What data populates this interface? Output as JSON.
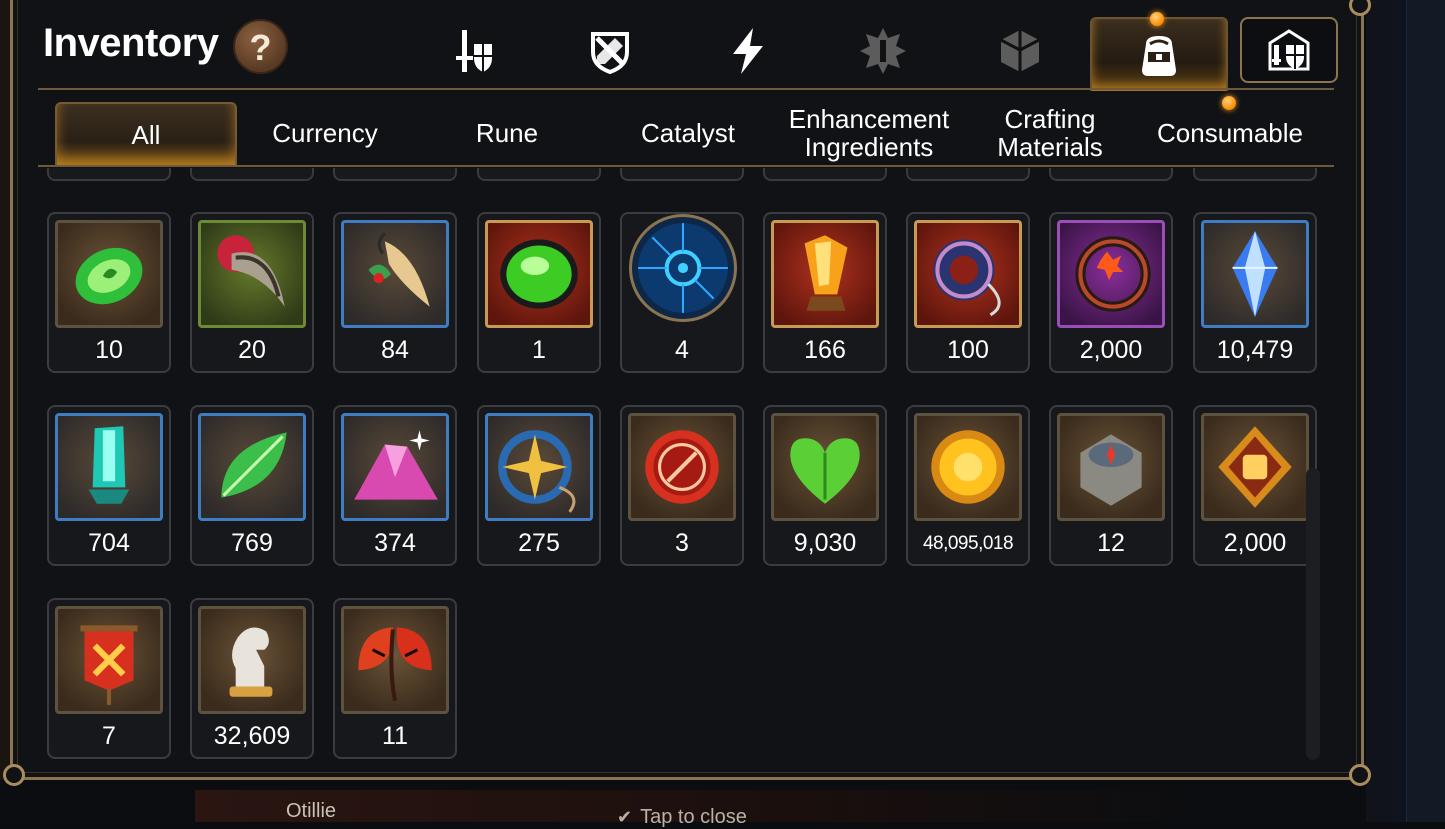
{
  "title": "Inventory",
  "help_label": "?",
  "top_tabs": [
    {
      "icon": "sword-shield-icon"
    },
    {
      "icon": "crossed-shield-icon"
    },
    {
      "icon": "lightning-icon"
    },
    {
      "icon": "artifact-icon"
    },
    {
      "icon": "cube-icon"
    },
    {
      "icon": "backpack-icon",
      "active": true
    },
    {
      "icon": "guild-castle-icon"
    }
  ],
  "category_tabs": [
    {
      "label": "All",
      "active": true
    },
    {
      "label": "Currency"
    },
    {
      "label": "Rune"
    },
    {
      "label": "Catalyst"
    },
    {
      "label": "Enhancement\nIngredients"
    },
    {
      "label": "Crafting\nMaterials"
    },
    {
      "label": "Consumable"
    }
  ],
  "items": [
    {
      "icon": "green-stone-icon",
      "count": "10"
    },
    {
      "icon": "claw-icon",
      "count": "20"
    },
    {
      "icon": "feather-charm-icon",
      "count": "84"
    },
    {
      "icon": "green-gem-icon",
      "count": "1"
    },
    {
      "icon": "blue-orb-icon",
      "count": "4"
    },
    {
      "icon": "fire-crystal-icon",
      "count": "166"
    },
    {
      "icon": "ring-charm-icon",
      "count": "100"
    },
    {
      "icon": "flower-ring-icon",
      "count": "2,000"
    },
    {
      "icon": "blue-crystal-icon",
      "count": "10,479"
    },
    {
      "icon": "teal-crystal-icon",
      "count": "704"
    },
    {
      "icon": "leaf-icon",
      "count": "769"
    },
    {
      "icon": "pink-powder-icon",
      "count": "374"
    },
    {
      "icon": "star-pendant-icon",
      "count": "275"
    },
    {
      "icon": "red-seal-icon",
      "count": "3"
    },
    {
      "icon": "green-heart-icon",
      "count": "9,030"
    },
    {
      "icon": "gold-coin-icon",
      "count": "48,095,018"
    },
    {
      "icon": "stone-compass-icon",
      "count": "12"
    },
    {
      "icon": "fist-emblem-icon",
      "count": "2,000"
    },
    {
      "icon": "banner-icon",
      "count": "7"
    },
    {
      "icon": "knight-piece-icon",
      "count": "32,609"
    },
    {
      "icon": "red-leaf-icon",
      "count": "11"
    }
  ],
  "background": {
    "character_name": "Otillie",
    "close_hint": "Tap to close"
  },
  "colors": {
    "panel_border": "#8b7450",
    "active_glow": "#ffaa28",
    "notification": "#ff8a00"
  }
}
